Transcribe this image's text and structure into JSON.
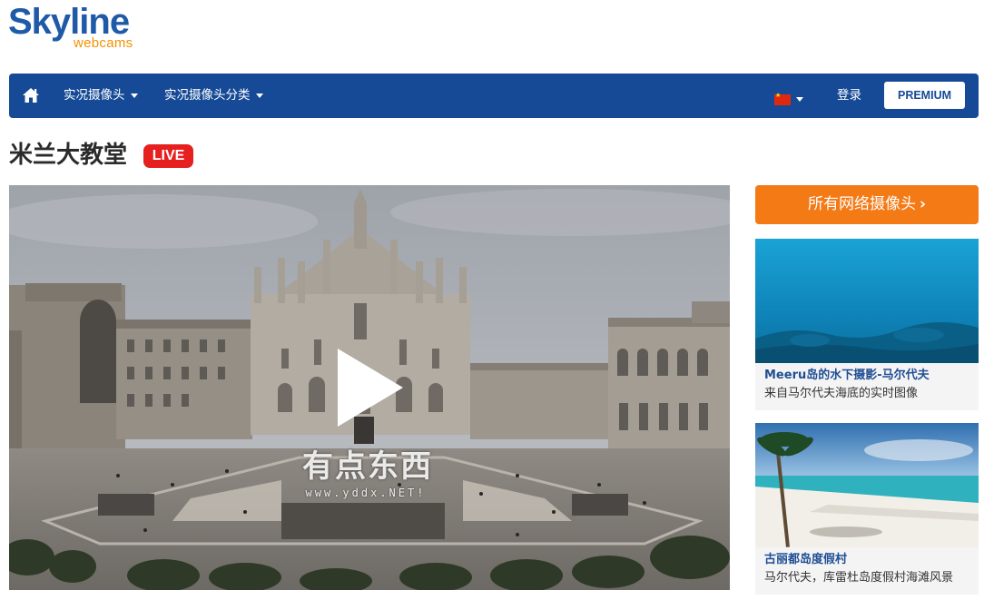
{
  "brand": {
    "name": "Skyline",
    "sub": "webcams"
  },
  "nav": {
    "home_icon": "home-icon",
    "items": [
      {
        "label": "实况摄像头"
      },
      {
        "label": "实况摄像头分类"
      }
    ],
    "language_flag": "china-flag-icon",
    "login_label": "登录",
    "premium_label": "PREMIUM"
  },
  "page": {
    "title": "米兰大教堂",
    "live_badge": "LIVE"
  },
  "video": {
    "play_icon": "play-icon",
    "watermark": "有点东西",
    "watermark_url": "www.yddx.NET!"
  },
  "sidebar": {
    "all_cams_label": "所有网络摄像头",
    "cards": [
      {
        "title": "Meeru岛的水下摄影-马尔代夫",
        "desc": "来自马尔代夫海底的实时图像"
      },
      {
        "title": "古丽都岛度假村",
        "desc": "马尔代夫，库雷杜岛度假村海滩风景"
      }
    ]
  },
  "colors": {
    "brand_blue": "#164a96",
    "logo_orange": "#f39200",
    "live_red": "#e5201f",
    "cta_orange": "#f47a16"
  }
}
